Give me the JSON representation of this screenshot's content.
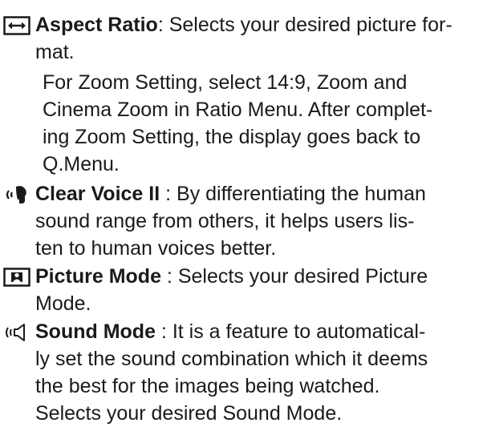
{
  "items": [
    {
      "icon": "aspect-ratio-icon",
      "term": "Aspect Ratio",
      "sep": ":",
      "lines": [
        " Selects your desired picture for-",
        "mat."
      ]
    },
    {
      "icon": "",
      "term": "",
      "sep": "",
      "lines": [
        "For Zoom Setting, select 14:9, Zoom and",
        "Cinema Zoom in Ratio Menu. After complet-",
        "ing Zoom Setting, the display goes back to",
        "Q.Menu."
      ]
    },
    {
      "icon": "clear-voice-icon",
      "term": "Clear Voice II",
      "sep": " :",
      "lines": [
        " By differentiating the human",
        "sound range from others, it helps users lis-",
        "ten to human voices better."
      ]
    },
    {
      "icon": "picture-mode-icon",
      "term": "Picture Mode",
      "sep": " :",
      "lines": [
        " Selects your desired Picture",
        "Mode."
      ]
    },
    {
      "icon": "sound-mode-icon",
      "term": "Sound Mode",
      "sep": " :",
      "lines": [
        " It is a feature to automatical-",
        "ly set the sound combination which it deems",
        "the best for the images being watched.",
        "Selects your desired Sound Mode."
      ]
    }
  ]
}
